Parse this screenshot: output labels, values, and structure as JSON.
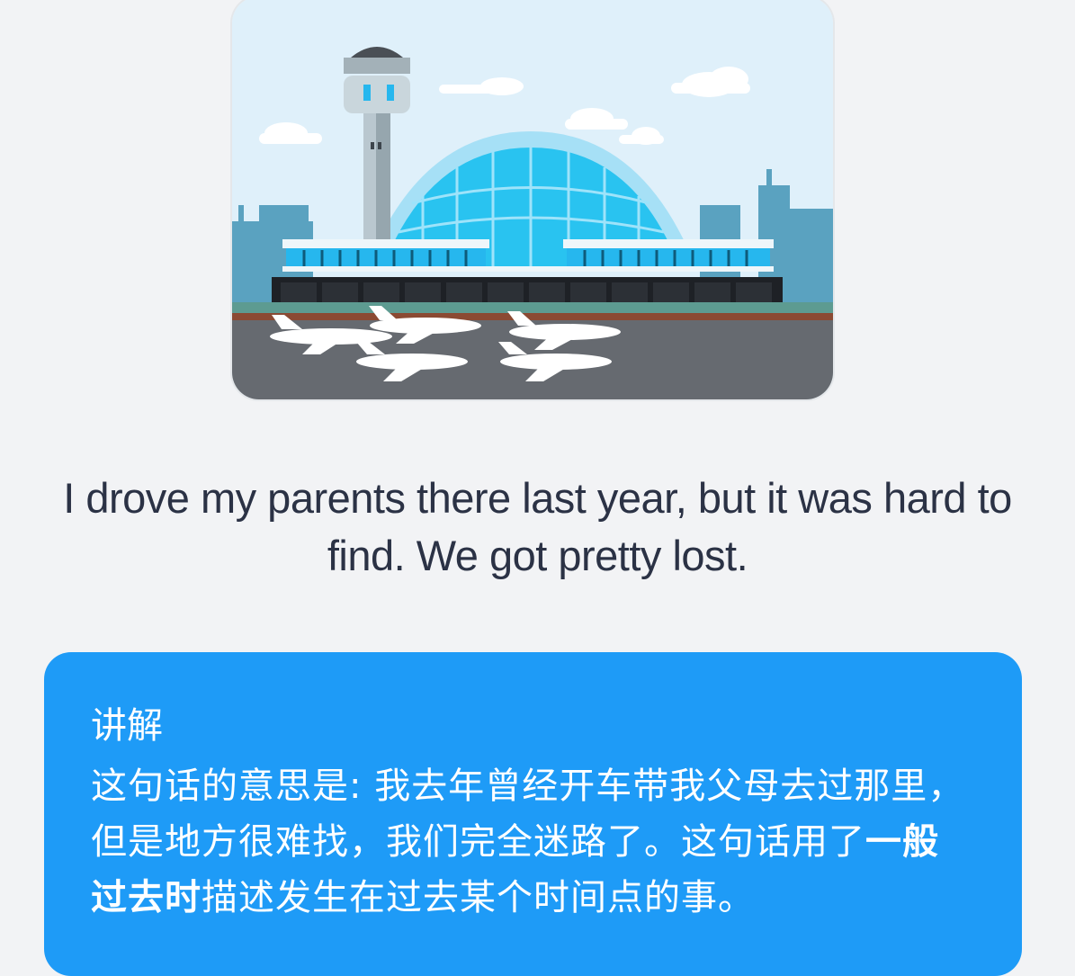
{
  "illustration": {
    "icon": "airport-terminal-illustration"
  },
  "sentence": "I drove my parents there last year, but it was hard to find. We got pretty lost.",
  "explanation": {
    "title": "讲解",
    "text_before": "这句话的意思是: 我去年曾经开车带我父母去过那里，但是地方很难找，我们完全迷路了。这句话用了",
    "highlight": "一般过去时",
    "text_after": "描述发生在过去某个时间点的事。"
  },
  "colors": {
    "background": "#f2f3f5",
    "card": "#1e9bf7",
    "text": "#2b3245",
    "sky": "#dff0fa",
    "dome": "#29c3f0"
  }
}
